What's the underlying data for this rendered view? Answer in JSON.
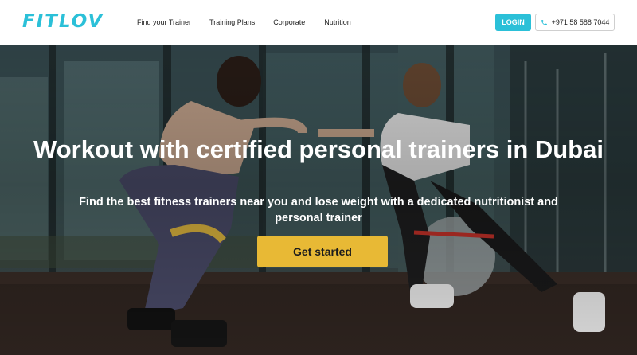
{
  "brand": {
    "logo_text": "FITLOV",
    "accent_color": "#2bc0d8",
    "cta_color": "#e8b935"
  },
  "nav": {
    "items": [
      {
        "label": "Find your Trainer"
      },
      {
        "label": "Training Plans"
      },
      {
        "label": "Corporate"
      },
      {
        "label": "Nutrition"
      }
    ]
  },
  "header": {
    "login_label": "LOGIN",
    "phone_icon": "phone-icon",
    "phone_number": "+971 58 588 7044"
  },
  "hero": {
    "headline_highlight": "Workout",
    "headline_rest": " with certified personal trainers in Dubai",
    "subheadline": "Find the best fitness trainers near you and lose weight with a dedicated nutritionist and personal trainer",
    "cta_label": "Get started"
  }
}
